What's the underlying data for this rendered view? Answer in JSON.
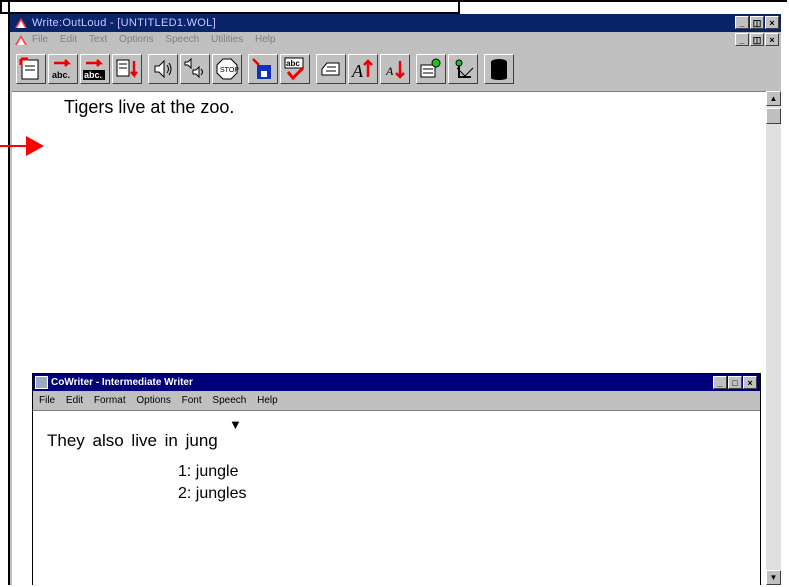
{
  "window": {
    "title": "Write:OutLoud - [UNTITLED1.WOL]"
  },
  "window_buttons": [
    "_",
    "×",
    "×"
  ],
  "menu": [
    "File",
    "Edit",
    "Text",
    "Options",
    "Speech",
    "Utilities",
    "Help"
  ],
  "toolbar": [
    {
      "name": "new-doc-button"
    },
    {
      "name": "speak-word-button"
    },
    {
      "name": "speak-sentence-button"
    },
    {
      "name": "speak-paragraph-button"
    },
    {
      "name": "speak-button"
    },
    {
      "name": "speak-selection-button"
    },
    {
      "name": "stop-button"
    },
    {
      "name": "save-button"
    },
    {
      "name": "spell-check-button"
    },
    {
      "name": "print-button"
    },
    {
      "name": "increase-font-button"
    },
    {
      "name": "decrease-font-button"
    },
    {
      "name": "homonym-button"
    },
    {
      "name": "cowriter-button"
    },
    {
      "name": "trash-button"
    }
  ],
  "document": {
    "text": "Tigers live at the zoo."
  },
  "cowriter": {
    "title": "CoWriter - Intermediate Writer",
    "menu": [
      "File",
      "Edit",
      "Format",
      "Options",
      "Font",
      "Speech",
      "Help"
    ],
    "text": "They also live in jung",
    "caret": "▼",
    "predictions": [
      "1: jungle",
      "2: jungles"
    ]
  },
  "colors": {
    "titlebar": "#0a246a",
    "cowriter_titlebar": "#00007a",
    "arrow": "#ff0000"
  }
}
